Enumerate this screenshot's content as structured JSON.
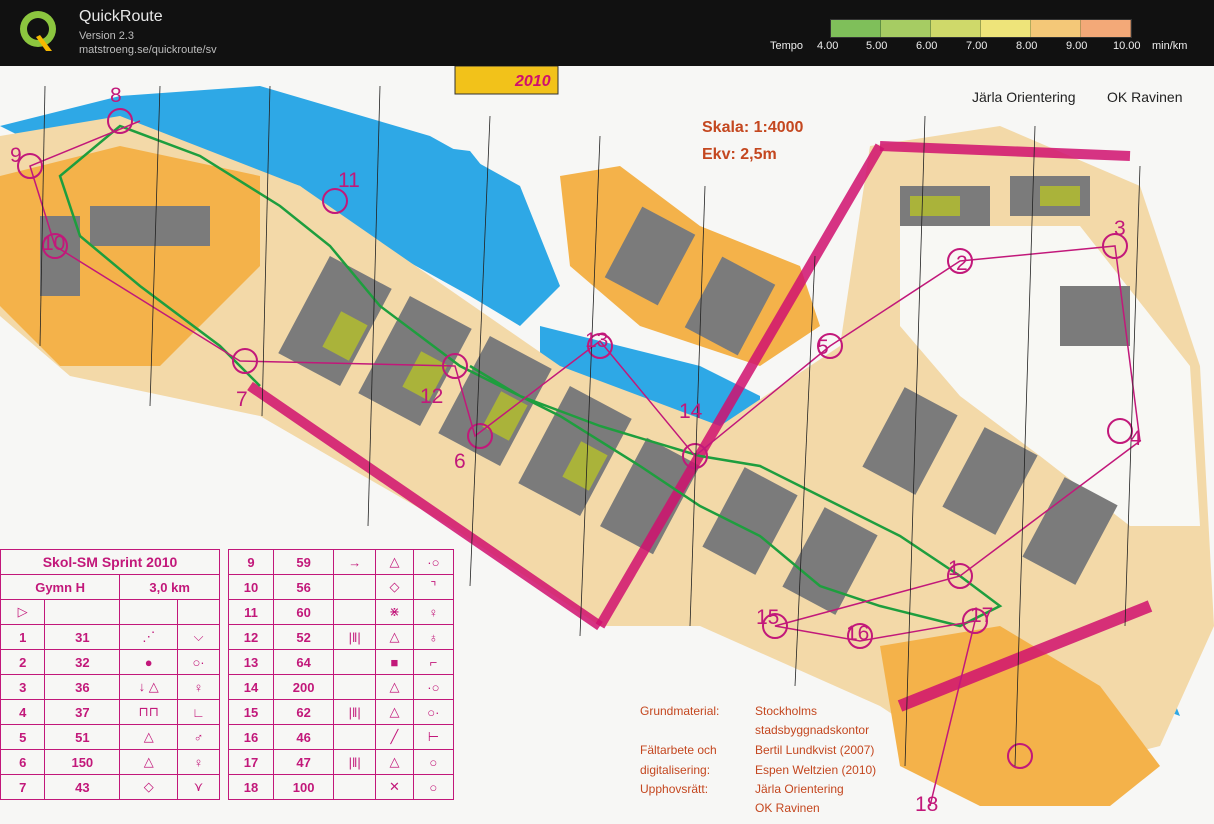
{
  "app": {
    "title": "QuickRoute",
    "version": "Version 2.3",
    "url": "matstroeng.se/quickroute/sv"
  },
  "tempo": {
    "label": "Tempo",
    "unit": "min/km",
    "ticks": [
      "4.00",
      "5.00",
      "6.00",
      "7.00",
      "8.00",
      "9.00",
      "10.00"
    ],
    "colors": [
      "#7fbf5a",
      "#a6cc63",
      "#cfd96a",
      "#eee47a",
      "#f4c878",
      "#f3a978",
      "#f28a78"
    ]
  },
  "map": {
    "event_logo_text": "2010",
    "clubs": [
      "Järla Orientering",
      "OK Ravinen"
    ],
    "scale": "Skala:  1:4000",
    "contour": "Ekv:    2,5m",
    "controls": [
      "8",
      "9",
      "10",
      "11",
      "7",
      "13",
      "12",
      "6",
      "14",
      "5",
      "2",
      "3",
      "4",
      "1",
      "15",
      "16",
      "17",
      "18"
    ],
    "credits": {
      "labels": [
        "Grundmaterial:",
        "Fältarbete och",
        "digitalisering:",
        "Upphovsrätt:"
      ],
      "values": [
        "Stockholms",
        "stadsbyggnadskontor",
        "Bertil Lundkvist (2007)",
        "Espen Weltzien (2010)",
        "Järla Orientering",
        "OK Ravinen"
      ]
    }
  },
  "control_description": {
    "title": "Skol-SM Sprint 2010",
    "class": "Gymn H",
    "length": "3,0 km",
    "left": [
      {
        "n": "1",
        "code": "31"
      },
      {
        "n": "2",
        "code": "32"
      },
      {
        "n": "3",
        "code": "36"
      },
      {
        "n": "4",
        "code": "37"
      },
      {
        "n": "5",
        "code": "51"
      },
      {
        "n": "6",
        "code": "150"
      },
      {
        "n": "7",
        "code": "43"
      }
    ],
    "right": [
      {
        "n": "9",
        "code": "59"
      },
      {
        "n": "10",
        "code": "56"
      },
      {
        "n": "11",
        "code": "60"
      },
      {
        "n": "12",
        "code": "52"
      },
      {
        "n": "13",
        "code": "64"
      },
      {
        "n": "14",
        "code": "200"
      },
      {
        "n": "15",
        "code": "62"
      },
      {
        "n": "16",
        "code": "46"
      },
      {
        "n": "17",
        "code": "47"
      },
      {
        "n": "18",
        "code": "100"
      }
    ]
  }
}
